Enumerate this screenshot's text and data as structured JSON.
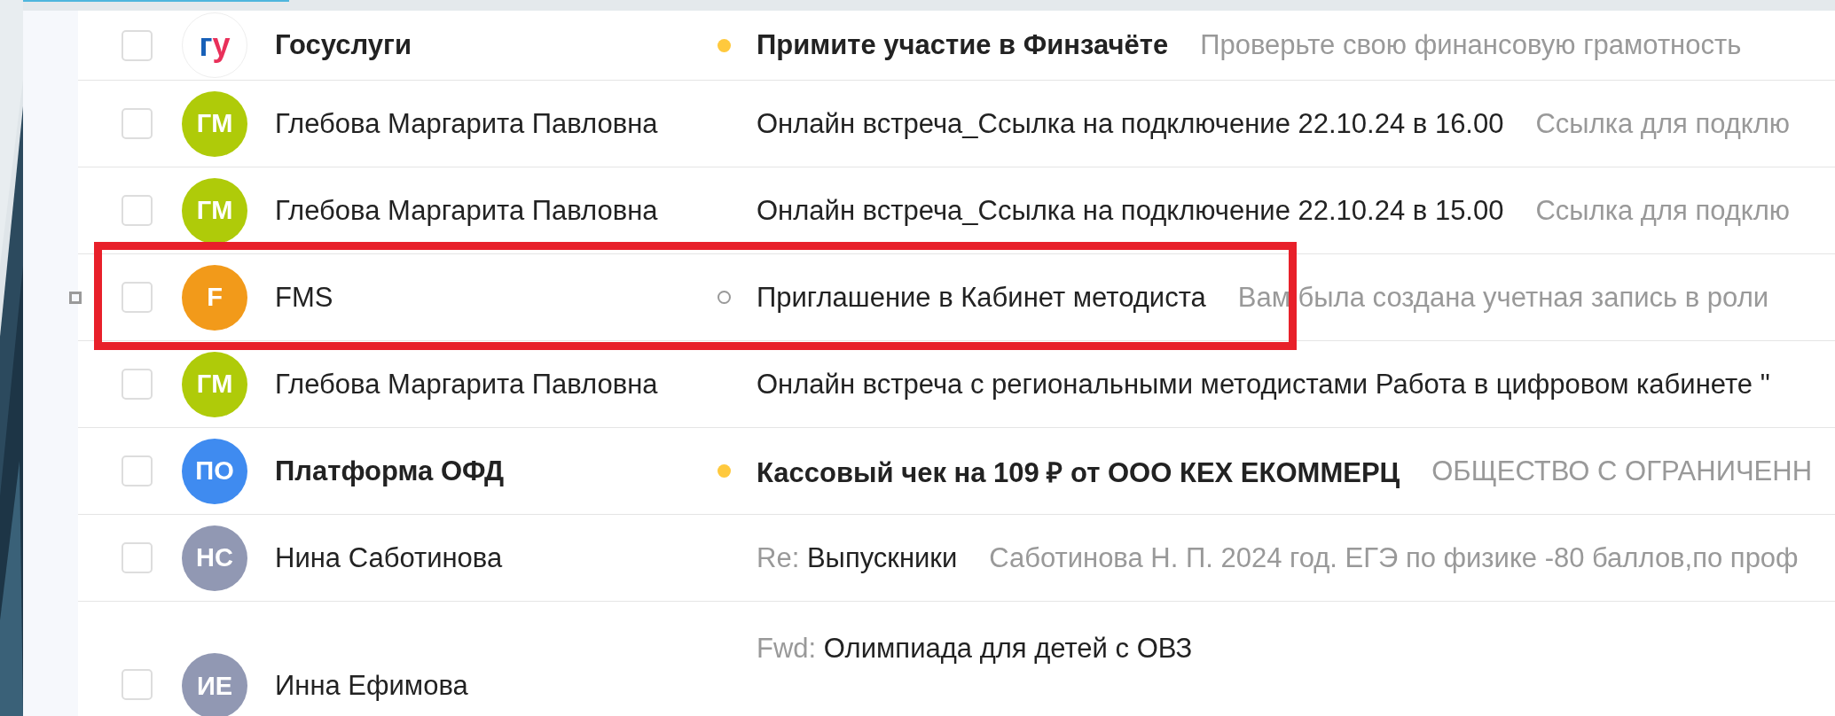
{
  "messages": [
    {
      "sender": "Госуслуги",
      "unread": true,
      "avatar": {
        "kind": "logo",
        "letters": [
          {
            "text": "г",
            "color": "#1760b8"
          },
          {
            "text": "у",
            "color": "#e9305a"
          }
        ]
      },
      "unread_dot": true,
      "read_ring": false,
      "subject": "Примите участие в Финзачёте",
      "snippet": "Проверьте свою финансовую грамотность",
      "highlighted": false,
      "hovered": false,
      "checked": false
    },
    {
      "sender": "Глебова Маргарита Павловна",
      "unread": false,
      "avatar": {
        "kind": "initials",
        "text": "ГМ",
        "color": "#afcb09"
      },
      "unread_dot": false,
      "read_ring": false,
      "subject": "Онлайн встреча_Ссылка на подключение 22.10.24 в 16.00",
      "snippet": "Ссылка для подклю",
      "highlighted": false,
      "hovered": false,
      "checked": false
    },
    {
      "sender": "Глебова Маргарита Павловна",
      "unread": false,
      "avatar": {
        "kind": "initials",
        "text": "ГМ",
        "color": "#afcb09"
      },
      "unread_dot": false,
      "read_ring": false,
      "subject": "Онлайн встреча_Ссылка на подключение 22.10.24 в 15.00",
      "snippet": "Ссылка для подклю",
      "highlighted": false,
      "hovered": false,
      "checked": false
    },
    {
      "sender": "FMS",
      "unread": false,
      "avatar": {
        "kind": "initials",
        "text": "F",
        "color": "#f29a1a"
      },
      "unread_dot": false,
      "read_ring": true,
      "subject": "Приглашение в Кабинет методиста",
      "snippet": "Вам была создана учетная запись в роли",
      "highlighted": true,
      "hovered": true,
      "checked": false
    },
    {
      "sender": "Глебова Маргарита Павловна",
      "unread": false,
      "avatar": {
        "kind": "initials",
        "text": "ГМ",
        "color": "#afcb09"
      },
      "unread_dot": false,
      "read_ring": false,
      "subject": "Онлайн встреча с региональными методистами Работа в цифровом кабинете \"",
      "highlighted": false,
      "hovered": false,
      "checked": false
    },
    {
      "sender": "Платформа ОФД",
      "unread": true,
      "avatar": {
        "kind": "initials",
        "text": "ПО",
        "color": "#3f8bf0"
      },
      "unread_dot": true,
      "read_ring": false,
      "subject": "Кассовый чек на 109 ₽ от ООО КЕХ ЕКОММЕРЦ",
      "snippet": "ОБЩЕСТВО С ОГРАНИЧЕНН",
      "highlighted": false,
      "hovered": false,
      "checked": false
    },
    {
      "sender": "Нина Саботинова",
      "unread": false,
      "avatar": {
        "kind": "initials",
        "text": "НС",
        "color": "#9198b3"
      },
      "unread_dot": false,
      "read_ring": false,
      "prefix": "Re:",
      "subject": "Выпускники",
      "snippet": "Саботинова Н. П. 2024 год. ЕГЭ по физике -80 баллов,по проф",
      "highlighted": false,
      "hovered": false,
      "checked": false
    },
    {
      "sender": "Инна Ефимова",
      "unread": false,
      "avatar": {
        "kind": "initials",
        "text": "ИЕ",
        "color": "#9198b3"
      },
      "unread_dot": false,
      "read_ring": false,
      "prefix": "Fwd:",
      "subject": "Олимпиада для детей с ОВЗ",
      "highlighted": false,
      "hovered": false,
      "checked": false
    }
  ]
}
